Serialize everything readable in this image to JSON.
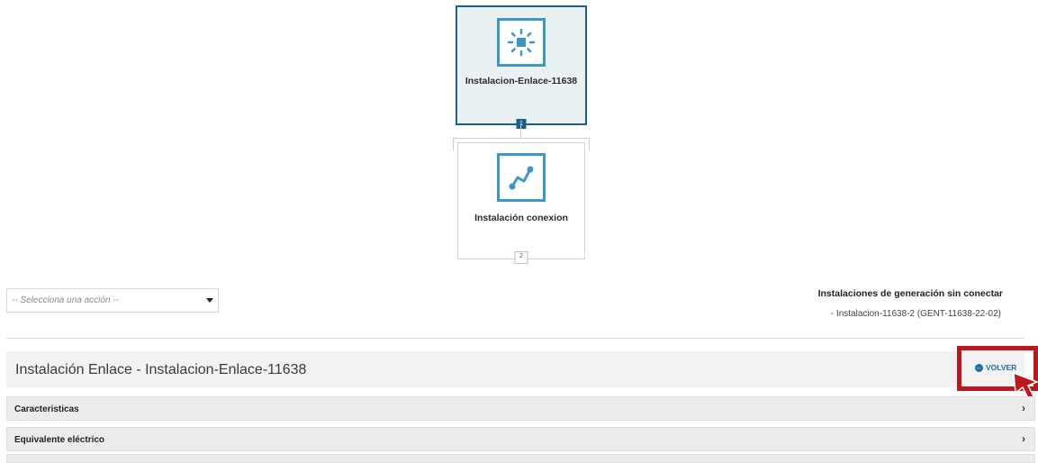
{
  "tree": {
    "root": {
      "label": "Instalacion-Enlace-11638",
      "badge": "1",
      "icon": "sun-square-icon",
      "selected": true
    },
    "child": {
      "label": "Instalación conexion",
      "badge": "2",
      "icon": "connection-line-icon"
    }
  },
  "action_select": {
    "placeholder": "-- Selecciona una acción --"
  },
  "unconnected": {
    "title": "Instalaciones de generación sin conectar",
    "items": [
      "- Instalacion-11638-2 (GENT-11638-22-02)"
    ]
  },
  "header": {
    "title": "Instalación Enlace - Instalacion-Enlace-11638",
    "back_label": "VOLVER",
    "back_icon": "arrow-left-circle-icon"
  },
  "sections": [
    {
      "label": "Caracteristicas",
      "chevron": "›"
    },
    {
      "label": "Equivalente eléctrico",
      "chevron": "›"
    },
    {
      "label": "",
      "chevron": ""
    }
  ],
  "colors": {
    "accent": "#1d5f88",
    "icon_blue": "#3b96c9",
    "highlight_red": "#c0161d",
    "link_blue": "#1d6ea3"
  }
}
